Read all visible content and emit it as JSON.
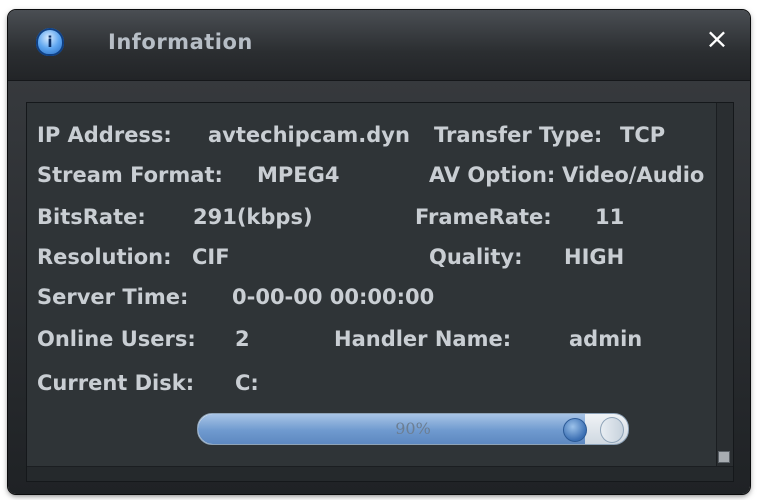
{
  "window": {
    "title": "Information",
    "close_label": "×"
  },
  "info": {
    "ip_label": "IP Address:",
    "ip_value": "avtechipcam.dyn",
    "transfer_label": "Transfer Type:",
    "transfer_value": "TCP",
    "stream_label": "Stream Format:",
    "stream_value": "MPEG4",
    "av_label": "AV Option:",
    "av_value": "Video/Audio",
    "bitrate_label": "BitsRate:",
    "bitrate_value": "291(kbps)",
    "framerate_label": "FrameRate:",
    "framerate_value": "11",
    "resolution_label": "Resolution:",
    "resolution_value": "CIF",
    "quality_label": "Quality:",
    "quality_value": "HIGH",
    "servertime_label": "Server Time:",
    "servertime_value": "0-00-00 00:00:00",
    "users_label": "Online Users:",
    "users_value": "2",
    "handler_label": "Handler Name:",
    "handler_value": "admin",
    "disk_label": "Current Disk:",
    "disk_value": "C:"
  },
  "progress": {
    "text": "90%",
    "value": 0.9
  },
  "colors": {
    "title_text": "#b7bec6",
    "body_text": "#c9ced3",
    "panel_bg": "#2f3437",
    "progress_fill": "#6f9acf"
  },
  "icons": {
    "title_icon": "info-shield-icon",
    "close_icon": "close-icon"
  }
}
